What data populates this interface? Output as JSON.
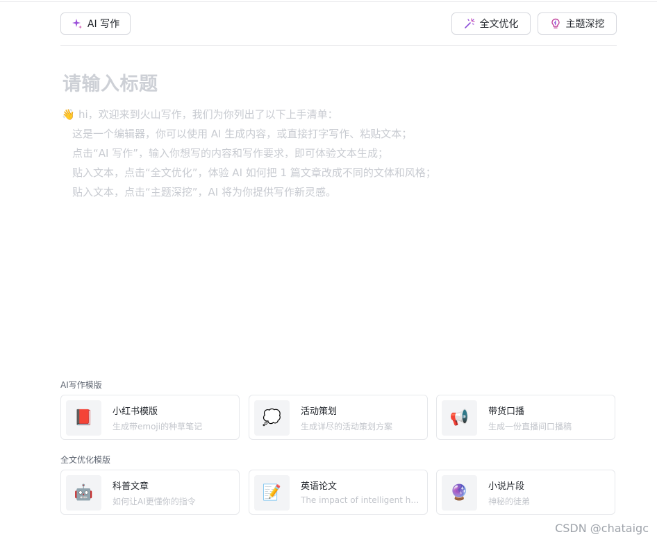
{
  "toolbar": {
    "ai_write_label": "AI 写作",
    "full_optimize_label": "全文优化",
    "topic_dig_label": "主题深挖"
  },
  "editor": {
    "title_placeholder": "请输入标题",
    "intro_lines": [
      "hi，欢迎来到火山写作，我们为你列出了以下上手清单：",
      "这是一个编辑器，你可以使用 AI 生成内容，或直接打字写作、粘贴文本；",
      "点击“AI 写作”，输入你想写的内容和写作要求，即可体验文本生成；",
      "贴入文本，点击“全文优化”，体验 AI 如何把 1 篇文章改成不同的文体和风格；",
      "贴入文本，点击“主题深挖”，AI 将为你提供写作新灵感。"
    ]
  },
  "ai_templates": {
    "section_label": "AI写作模版",
    "cards": [
      {
        "emoji": "📕",
        "icon": "red-book-icon",
        "name": "小红书模版",
        "desc": "生成带emoji的种草笔记"
      },
      {
        "emoji": "💭",
        "icon": "thought-bubble-icon",
        "name": "活动策划",
        "desc": "生成详尽的活动策划方案"
      },
      {
        "emoji": "📢",
        "icon": "megaphone-icon",
        "name": "带货口播",
        "desc": "生成一份直播间口播稿"
      }
    ]
  },
  "optimize_templates": {
    "section_label": "全文优化模版",
    "cards": [
      {
        "emoji": "🤖",
        "icon": "robot-icon",
        "name": "科普文章",
        "desc": "如何让AI更懂你的指令"
      },
      {
        "emoji": "📝",
        "icon": "memo-icon",
        "name": "英语论文",
        "desc": "The impact of intelligent hou…"
      },
      {
        "emoji": "🔮",
        "icon": "crystal-ball-icon",
        "name": "小说片段",
        "desc": "神秘的徒弟"
      }
    ]
  },
  "watermark": "CSDN @chataigc",
  "colors": {
    "accent_purple": "#8a4dd8",
    "placeholder_gray": "#cdd0d6"
  }
}
